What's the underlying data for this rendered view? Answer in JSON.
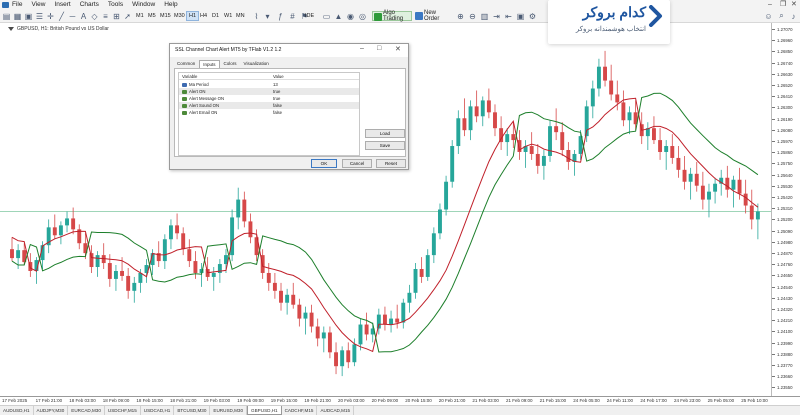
{
  "menu": {
    "items": [
      "File",
      "View",
      "Insert",
      "Charts",
      "Tools",
      "Window",
      "Help"
    ]
  },
  "toolbar": {
    "timeframes": [
      "M1",
      "M5",
      "M15",
      "M30",
      "H1",
      "H4",
      "D1",
      "W1",
      "MN"
    ],
    "active_timeframe": "H1",
    "algo_label": "Algo Trading",
    "new_order_label": "New Order",
    "ide_label": "IDE"
  },
  "chart": {
    "caption": "GBPUSD, H1:  British Pound vs US Dollar",
    "price_ticks": [
      "1.27070",
      "1.26960",
      "1.26850",
      "1.26740",
      "1.26630",
      "1.26520",
      "1.26410",
      "1.26300",
      "1.26190",
      "1.26080",
      "1.25970",
      "1.25860",
      "1.25750",
      "1.25640",
      "1.25530",
      "1.25420",
      "1.25310",
      "1.25200",
      "1.25090",
      "1.24980",
      "1.24870",
      "1.24760",
      "1.24650",
      "1.24540",
      "1.24430",
      "1.24320",
      "1.24210",
      "1.24100",
      "1.23990",
      "1.23880",
      "1.23770",
      "1.23660",
      "1.23550"
    ],
    "time_ticks": [
      "17 Feb 2025",
      "17 Feb 21:00",
      "18 Feb 03:00",
      "18 Feb 09:00",
      "18 Feb 15:00",
      "18 Feb 21:00",
      "19 Feb 03:00",
      "19 Feb 09:00",
      "19 Feb 15:00",
      "19 Feb 21:00",
      "20 Feb 03:00",
      "20 Feb 09:00",
      "20 Feb 15:00",
      "20 Feb 21:00",
      "21 Feb 03:00",
      "21 Feb 09:00",
      "21 Feb 15:00",
      "24 Feb 05:00",
      "24 Feb 11:00",
      "24 Feb 17:00",
      "24 Feb 23:00",
      "25 Feb 05:00",
      "25 Feb 10:00"
    ],
    "colors": {
      "bull": "#26a69a",
      "bear": "#d64848",
      "channel": "#c0202a",
      "ssl": "#1d7f2b",
      "hline": "#7fc7a0"
    }
  },
  "chart_data": {
    "type": "candlestick",
    "symbol": "GBPUSD",
    "timeframe": "H1",
    "ylim": [
      1.235,
      1.271
    ],
    "candles": [
      [
        1.249,
        1.2502,
        1.2478,
        1.2481
      ],
      [
        1.2481,
        1.2495,
        1.247,
        1.2489
      ],
      [
        1.2489,
        1.2496,
        1.2474,
        1.2477
      ],
      [
        1.2477,
        1.2486,
        1.2462,
        1.2468
      ],
      [
        1.2468,
        1.2482,
        1.2455,
        1.2479
      ],
      [
        1.2479,
        1.2498,
        1.247,
        1.2494
      ],
      [
        1.2494,
        1.252,
        1.2486,
        1.2512
      ],
      [
        1.2512,
        1.2525,
        1.25,
        1.2504
      ],
      [
        1.2504,
        1.2518,
        1.2495,
        1.2514
      ],
      [
        1.2514,
        1.2528,
        1.2507,
        1.2521
      ],
      [
        1.2521,
        1.2532,
        1.2505,
        1.251
      ],
      [
        1.251,
        1.2515,
        1.249,
        1.2496
      ],
      [
        1.2496,
        1.2506,
        1.248,
        1.2486
      ],
      [
        1.2486,
        1.2494,
        1.2466,
        1.2472
      ],
      [
        1.2472,
        1.2488,
        1.2462,
        1.2484
      ],
      [
        1.2484,
        1.2496,
        1.247,
        1.2476
      ],
      [
        1.2476,
        1.2485,
        1.2452,
        1.246
      ],
      [
        1.246,
        1.2474,
        1.2448,
        1.2468
      ],
      [
        1.2468,
        1.2482,
        1.2458,
        1.2463
      ],
      [
        1.2463,
        1.2471,
        1.244,
        1.2448
      ],
      [
        1.2448,
        1.2462,
        1.2436,
        1.2456
      ],
      [
        1.2456,
        1.247,
        1.2446,
        1.2466
      ],
      [
        1.2466,
        1.248,
        1.2456,
        1.2474
      ],
      [
        1.2474,
        1.249,
        1.2464,
        1.2486
      ],
      [
        1.2486,
        1.2498,
        1.2472,
        1.2478
      ],
      [
        1.2478,
        1.2505,
        1.247,
        1.25
      ],
      [
        1.25,
        1.252,
        1.249,
        1.2514
      ],
      [
        1.2514,
        1.2526,
        1.25,
        1.2506
      ],
      [
        1.2506,
        1.2512,
        1.2484,
        1.249
      ],
      [
        1.249,
        1.25,
        1.2472,
        1.2478
      ],
      [
        1.2478,
        1.2488,
        1.246,
        1.2466
      ],
      [
        1.2466,
        1.2476,
        1.2452,
        1.247
      ],
      [
        1.247,
        1.2482,
        1.2458,
        1.2462
      ],
      [
        1.2462,
        1.2472,
        1.2448,
        1.2466
      ],
      [
        1.2466,
        1.248,
        1.2456,
        1.2475
      ],
      [
        1.2475,
        1.249,
        1.2466,
        1.2484
      ],
      [
        1.2484,
        1.253,
        1.2478,
        1.2522
      ],
      [
        1.2522,
        1.2552,
        1.251,
        1.254
      ],
      [
        1.254,
        1.2548,
        1.2512,
        1.2518
      ],
      [
        1.2518,
        1.2526,
        1.2496,
        1.2502
      ],
      [
        1.2502,
        1.251,
        1.2478,
        1.2484
      ],
      [
        1.2484,
        1.249,
        1.246,
        1.2466
      ],
      [
        1.2466,
        1.2476,
        1.2448,
        1.2456
      ],
      [
        1.2456,
        1.2466,
        1.244,
        1.2448
      ],
      [
        1.2448,
        1.2456,
        1.2428,
        1.2436
      ],
      [
        1.2436,
        1.245,
        1.2424,
        1.2444
      ],
      [
        1.2444,
        1.2456,
        1.243,
        1.2434
      ],
      [
        1.2434,
        1.244,
        1.2412,
        1.242
      ],
      [
        1.242,
        1.2432,
        1.2404,
        1.2426
      ],
      [
        1.2426,
        1.2434,
        1.2406,
        1.2412
      ],
      [
        1.2412,
        1.242,
        1.2392,
        1.24
      ],
      [
        1.24,
        1.2412,
        1.2386,
        1.2406
      ],
      [
        1.2406,
        1.2412,
        1.238,
        1.2386
      ],
      [
        1.2386,
        1.2396,
        1.2364,
        1.2372
      ],
      [
        1.2372,
        1.2392,
        1.2362,
        1.2388
      ],
      [
        1.2388,
        1.2396,
        1.237,
        1.2376
      ],
      [
        1.2376,
        1.24,
        1.2372,
        1.2394
      ],
      [
        1.2394,
        1.242,
        1.2388,
        1.2414
      ],
      [
        1.2414,
        1.2426,
        1.2398,
        1.2404
      ],
      [
        1.2404,
        1.2416,
        1.2396,
        1.241
      ],
      [
        1.241,
        1.243,
        1.2404,
        1.2424
      ],
      [
        1.2424,
        1.2432,
        1.2408,
        1.2414
      ],
      [
        1.2414,
        1.2428,
        1.2406,
        1.242
      ],
      [
        1.242,
        1.2434,
        1.241,
        1.2416
      ],
      [
        1.2416,
        1.244,
        1.241,
        1.2436
      ],
      [
        1.2436,
        1.2454,
        1.2426,
        1.2446
      ],
      [
        1.2446,
        1.2476,
        1.244,
        1.247
      ],
      [
        1.247,
        1.2482,
        1.2456,
        1.2462
      ],
      [
        1.2462,
        1.249,
        1.2458,
        1.2484
      ],
      [
        1.2484,
        1.2512,
        1.2476,
        1.2506
      ],
      [
        1.2506,
        1.2536,
        1.25,
        1.253
      ],
      [
        1.253,
        1.2564,
        1.2524,
        1.2558
      ],
      [
        1.2558,
        1.26,
        1.2552,
        1.2594
      ],
      [
        1.2594,
        1.263,
        1.2586,
        1.2622
      ],
      [
        1.2622,
        1.2642,
        1.2604,
        1.261
      ],
      [
        1.261,
        1.264,
        1.26,
        1.2634
      ],
      [
        1.2634,
        1.265,
        1.2618,
        1.2624
      ],
      [
        1.2624,
        1.2644,
        1.2614,
        1.264
      ],
      [
        1.264,
        1.2652,
        1.2622,
        1.2628
      ],
      [
        1.2628,
        1.2636,
        1.2604,
        1.2612
      ],
      [
        1.2612,
        1.2624,
        1.259,
        1.2598
      ],
      [
        1.2598,
        1.2612,
        1.2584,
        1.2606
      ],
      [
        1.2606,
        1.2618,
        1.2592,
        1.26
      ],
      [
        1.26,
        1.261,
        1.258,
        1.2588
      ],
      [
        1.2588,
        1.26,
        1.2572,
        1.2594
      ],
      [
        1.2594,
        1.2608,
        1.258,
        1.2586
      ],
      [
        1.2586,
        1.2596,
        1.2566,
        1.2574
      ],
      [
        1.2574,
        1.259,
        1.256,
        1.2584
      ],
      [
        1.2584,
        1.262,
        1.2578,
        1.2614
      ],
      [
        1.2614,
        1.2632,
        1.26,
        1.2608
      ],
      [
        1.2608,
        1.2618,
        1.2584,
        1.259
      ],
      [
        1.259,
        1.2598,
        1.257,
        1.2578
      ],
      [
        1.2578,
        1.259,
        1.2564,
        1.2586
      ],
      [
        1.2586,
        1.261,
        1.258,
        1.2604
      ],
      [
        1.2604,
        1.264,
        1.2598,
        1.2634
      ],
      [
        1.2634,
        1.266,
        1.2622,
        1.2652
      ],
      [
        1.2652,
        1.2682,
        1.2644,
        1.2674
      ],
      [
        1.2674,
        1.269,
        1.2654,
        1.266
      ],
      [
        1.266,
        1.2676,
        1.264,
        1.2646
      ],
      [
        1.2646,
        1.266,
        1.263,
        1.2638
      ],
      [
        1.2638,
        1.265,
        1.2614,
        1.262
      ],
      [
        1.262,
        1.2634,
        1.2606,
        1.2628
      ],
      [
        1.2628,
        1.264,
        1.261,
        1.2616
      ],
      [
        1.2616,
        1.2628,
        1.2596,
        1.2604
      ],
      [
        1.2604,
        1.2618,
        1.259,
        1.2612
      ],
      [
        1.2612,
        1.2624,
        1.2596,
        1.26
      ],
      [
        1.26,
        1.2612,
        1.258,
        1.2588
      ],
      [
        1.2588,
        1.26,
        1.257,
        1.2594
      ],
      [
        1.2594,
        1.2606,
        1.2576,
        1.2582
      ],
      [
        1.2582,
        1.2594,
        1.2562,
        1.257
      ],
      [
        1.257,
        1.2584,
        1.255,
        1.2558
      ],
      [
        1.2558,
        1.2572,
        1.254,
        1.2566
      ],
      [
        1.2566,
        1.2578,
        1.2548,
        1.2554
      ],
      [
        1.2554,
        1.2568,
        1.253,
        1.254
      ],
      [
        1.254,
        1.2556,
        1.2522,
        1.2548
      ],
      [
        1.2548,
        1.2562,
        1.2536,
        1.2556
      ],
      [
        1.2556,
        1.257,
        1.2544,
        1.2562
      ],
      [
        1.2562,
        1.2574,
        1.2542,
        1.255
      ],
      [
        1.255,
        1.2564,
        1.2532,
        1.256
      ],
      [
        1.256,
        1.2572,
        1.254,
        1.2546
      ],
      [
        1.2546,
        1.256,
        1.2526,
        1.2534
      ],
      [
        1.2534,
        1.255,
        1.251,
        1.252
      ],
      [
        1.252,
        1.2536,
        1.25,
        1.2528
      ]
    ]
  },
  "dialog": {
    "title": "SSL Channel Chart Alert MT5 by TFlab V1.2 1.2",
    "tabs": [
      "Common",
      "Inputs",
      "Colors",
      "Visualization"
    ],
    "active_tab": "Inputs",
    "columns": [
      "Variable",
      "Value"
    ],
    "params": [
      {
        "name": "Ma Period",
        "value": "13",
        "icon": "int"
      },
      {
        "name": "Alert ON",
        "value": "true",
        "icon": "bool"
      },
      {
        "name": "Alert Message ON",
        "value": "true",
        "icon": "bool"
      },
      {
        "name": "Alert Sound ON",
        "value": "false",
        "icon": "bool"
      },
      {
        "name": "Alert Email ON",
        "value": "false",
        "icon": "bool"
      }
    ],
    "load_label": "Load",
    "save_label": "Save",
    "ok_label": "OK",
    "cancel_label": "Cancel",
    "reset_label": "Reset"
  },
  "ad": {
    "brand": "کدام بروکر",
    "subtitle": "انتخاب هوشمندانه بروکر"
  },
  "symbol_tabs": [
    "AUDUSD,H1",
    "AUDJPY,M30",
    "EURCAD,M30",
    "USDCHF,M15",
    "USDCAD,H1",
    "BTCUSD,M30",
    "EURUSD,M30",
    "GBPUSD,H1",
    "CADCHF,M15",
    "AUDCAD,M15"
  ],
  "active_symbol_tab": "GBPUSD,H1"
}
